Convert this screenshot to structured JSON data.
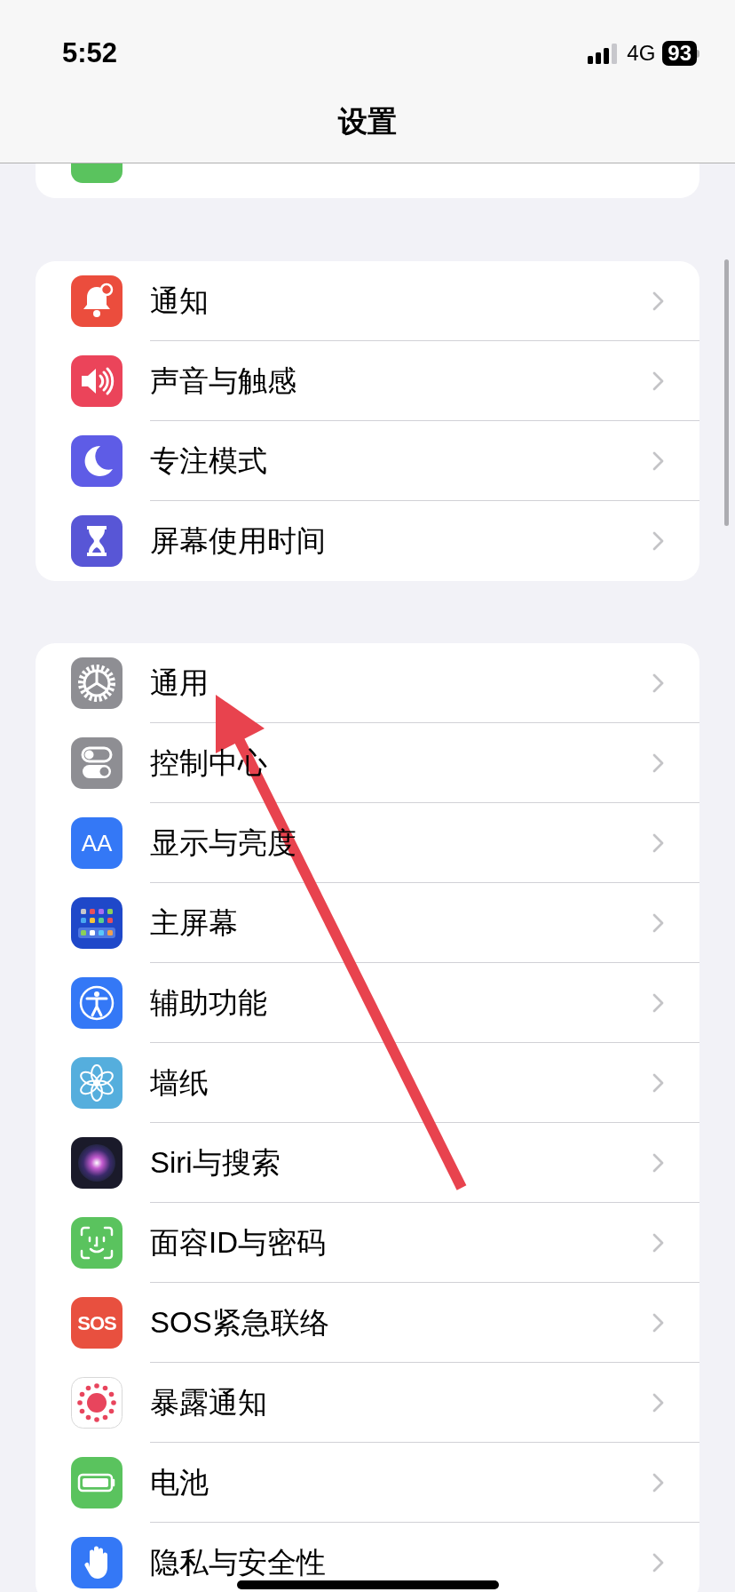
{
  "status_bar": {
    "time": "5:52",
    "network": "4G",
    "battery": "93"
  },
  "title": "设置",
  "groups": [
    [
      {
        "label": "通知"
      },
      {
        "label": "声音与触感"
      },
      {
        "label": "专注模式"
      },
      {
        "label": "屏幕使用时间"
      }
    ],
    [
      {
        "label": "通用"
      },
      {
        "label": "控制中心"
      },
      {
        "label": "显示与亮度",
        "icon_text": "AA"
      },
      {
        "label": "主屏幕"
      },
      {
        "label": "辅助功能"
      },
      {
        "label": "墙纸"
      },
      {
        "label": "Siri与搜索"
      },
      {
        "label": "面容ID与密码"
      },
      {
        "label": "SOS紧急联络",
        "icon_text": "SOS"
      },
      {
        "label": "暴露通知"
      },
      {
        "label": "电池"
      },
      {
        "label": "隐私与安全性"
      }
    ]
  ]
}
